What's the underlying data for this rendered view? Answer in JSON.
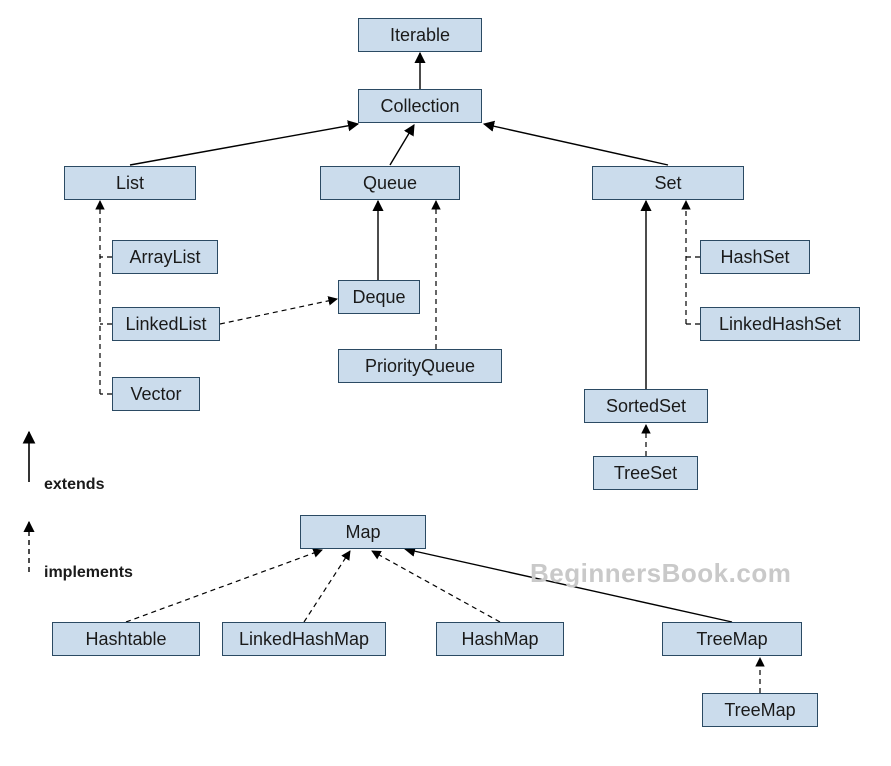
{
  "nodes": {
    "iterable": {
      "label": "Iterable"
    },
    "collection": {
      "label": "Collection"
    },
    "list": {
      "label": "List"
    },
    "queue": {
      "label": "Queue"
    },
    "set": {
      "label": "Set"
    },
    "arraylist": {
      "label": "ArrayList"
    },
    "linkedlist": {
      "label": "LinkedList"
    },
    "vector": {
      "label": "Vector"
    },
    "deque": {
      "label": "Deque"
    },
    "priorityqueue": {
      "label": "PriorityQueue"
    },
    "hashset": {
      "label": "HashSet"
    },
    "linkedhashset": {
      "label": "LinkedHashSet"
    },
    "sortedset": {
      "label": "SortedSet"
    },
    "treeset": {
      "label": "TreeSet"
    },
    "map": {
      "label": "Map"
    },
    "hashtable": {
      "label": "Hashtable"
    },
    "linkedhashmap": {
      "label": "LinkedHashMap"
    },
    "hashmap": {
      "label": "HashMap"
    },
    "treemap": {
      "label": "TreeMap"
    },
    "treemap2": {
      "label": "TreeMap"
    }
  },
  "legend": {
    "extends": "extends",
    "implements": "implements"
  },
  "watermark": "BeginnersBook.com",
  "colors": {
    "node_fill": "#cbdcec",
    "node_border": "#2b4a63",
    "line": "#000000",
    "watermark": "#c9c9c9"
  },
  "edges": [
    {
      "from": "collection",
      "to": "iterable",
      "style": "solid"
    },
    {
      "from": "list",
      "to": "collection",
      "style": "solid"
    },
    {
      "from": "queue",
      "to": "collection",
      "style": "solid"
    },
    {
      "from": "set",
      "to": "collection",
      "style": "solid"
    },
    {
      "from": "arraylist",
      "to": "list",
      "style": "dashed"
    },
    {
      "from": "linkedlist",
      "to": "list",
      "style": "dashed"
    },
    {
      "from": "vector",
      "to": "list",
      "style": "dashed"
    },
    {
      "from": "deque",
      "to": "queue",
      "style": "solid"
    },
    {
      "from": "priorityqueue",
      "to": "queue",
      "style": "dashed"
    },
    {
      "from": "linkedlist",
      "to": "deque",
      "style": "dashed"
    },
    {
      "from": "hashset",
      "to": "set",
      "style": "dashed"
    },
    {
      "from": "linkedhashset",
      "to": "set",
      "style": "dashed"
    },
    {
      "from": "sortedset",
      "to": "set",
      "style": "solid"
    },
    {
      "from": "treeset",
      "to": "sortedset",
      "style": "dashed"
    },
    {
      "from": "hashtable",
      "to": "map",
      "style": "dashed"
    },
    {
      "from": "linkedhashmap",
      "to": "map",
      "style": "dashed"
    },
    {
      "from": "hashmap",
      "to": "map",
      "style": "dashed"
    },
    {
      "from": "treemap",
      "to": "map",
      "style": "solid"
    },
    {
      "from": "treemap2",
      "to": "treemap",
      "style": "dashed"
    }
  ]
}
